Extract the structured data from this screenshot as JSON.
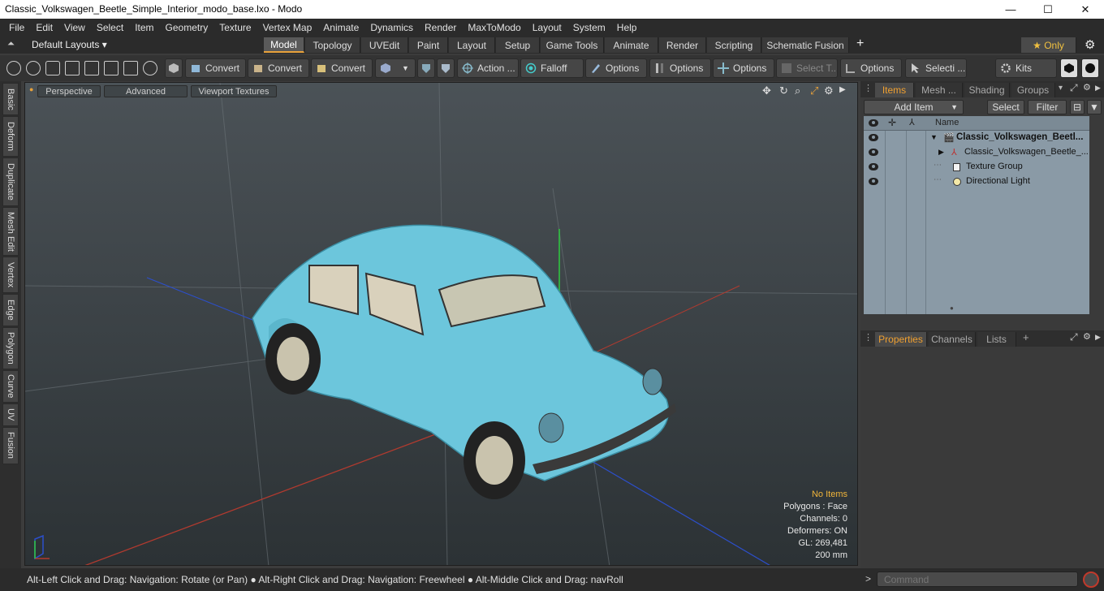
{
  "window": {
    "title": "Classic_Volkswagen_Beetle_Simple_Interior_modo_base.lxo - Modo",
    "minimize": "—",
    "maximize": "☐",
    "close": "✕"
  },
  "menu": [
    "File",
    "Edit",
    "View",
    "Select",
    "Item",
    "Geometry",
    "Texture",
    "Vertex Map",
    "Animate",
    "Dynamics",
    "Render",
    "MaxToModo",
    "Layout",
    "System",
    "Help"
  ],
  "layouts": {
    "label": "Default Layouts ▾",
    "tabs": [
      "Model",
      "Topology",
      "UVEdit",
      "Paint",
      "Layout",
      "Setup",
      "Game Tools",
      "Animate",
      "Render",
      "Scripting",
      "Schematic Fusion"
    ],
    "active": "Model",
    "plus": "+",
    "only": "★  Only",
    "gear": "⚙"
  },
  "toolbar": {
    "convert1": "Convert",
    "convert2": "Convert",
    "convert3": "Convert",
    "action": "Action  ...",
    "falloff": "Falloff",
    "options1": "Options",
    "options2": "Options",
    "options3": "Options",
    "select_t": "Select T...",
    "options4": "Options",
    "selecti": "Selecti ...",
    "kits": "Kits"
  },
  "left_tabs": [
    "Basic",
    "Deform",
    "Duplicate",
    "Mesh Edit",
    "Vertex",
    "Edge",
    "Polygon",
    "Curve",
    "UV",
    "Fusion"
  ],
  "viewport": {
    "tabs": [
      "Perspective",
      "Advanced",
      "Viewport Textures"
    ],
    "stats": {
      "items": "No Items",
      "polygons": "Polygons : Face",
      "channels": "Channels: 0",
      "deformers": "Deformers: ON",
      "gl": "GL: 269,481",
      "scale": "200 mm"
    },
    "colors": {
      "car_body": "#6cc6dc",
      "axis_x": "#c0392b",
      "axis_y": "#2ecc40",
      "axis_z": "#2c4fcc"
    }
  },
  "status": "Alt-Left Click and Drag: Navigation: Rotate (or Pan) ● Alt-Right Click and Drag: Navigation: Freewheel ● Alt-Middle Click and Drag: navRoll",
  "command": {
    "placeholder": "Command",
    "prompt": ">"
  },
  "items_panel": {
    "tabs": [
      "Items",
      "Mesh ...",
      "Shading",
      "Groups"
    ],
    "add_item": "Add Item",
    "select": "Select",
    "filter": "Filter",
    "name_header": "Name",
    "rows": [
      {
        "label": "Classic_Volkswagen_Beetl...",
        "bold": true
      },
      {
        "label": "Classic_Volkswagen_Beetle_..."
      },
      {
        "label": "Texture Group"
      },
      {
        "label": "Directional Light"
      }
    ]
  },
  "properties_panel": {
    "tabs": [
      "Properties",
      "Channels",
      "Lists"
    ],
    "plus": "+"
  }
}
